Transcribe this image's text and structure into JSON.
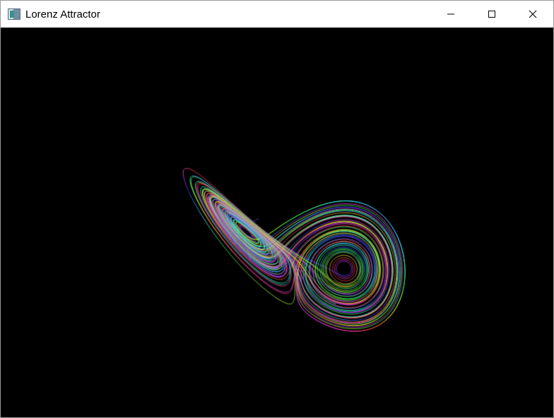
{
  "window": {
    "title": "Lorenz Attractor",
    "icon": "app-window-icon"
  },
  "controls": {
    "minimize_icon": "minimize-icon",
    "maximize_icon": "maximize-icon",
    "close_icon": "close-icon"
  },
  "canvas": {
    "background": "#000000",
    "palette": [
      "#00ffff",
      "#66ffdd",
      "#aaffaa",
      "#ffcc66",
      "#ff8844",
      "#ff3366",
      "#ff66cc",
      "#cc99ff",
      "#99ccff"
    ]
  }
}
